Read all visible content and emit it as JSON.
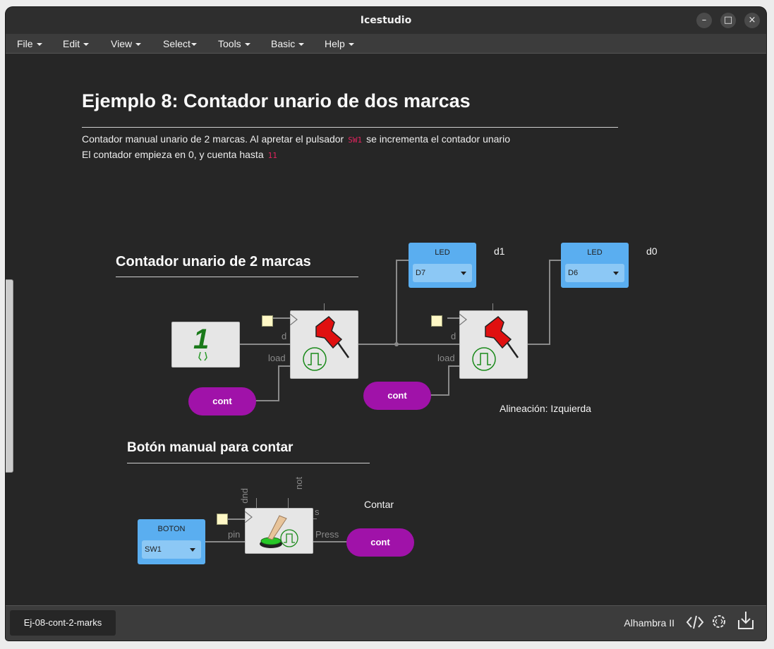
{
  "window": {
    "title": "Icestudio"
  },
  "menu": [
    {
      "label": "File"
    },
    {
      "label": "Edit"
    },
    {
      "label": "View"
    },
    {
      "label": "Select"
    },
    {
      "label": "Tools"
    },
    {
      "label": "Basic"
    },
    {
      "label": "Help"
    }
  ],
  "doc": {
    "title": "Ejemplo 8: Contador unario de dos marcas",
    "line1_a": "Contador manual unario de 2 marcas. Al apretar el pulsador",
    "line1_code": "SW1",
    "line1_b": "se incrementa el contador unario",
    "line2_a": "El contador empieza en 0, y cuenta hasta",
    "line2_code": "11"
  },
  "sections": {
    "counter_title": "Contador unario de 2 marcas",
    "button_title": "Botón manual para contar"
  },
  "circuit": {
    "led1": {
      "label": "LED",
      "pin": "D7",
      "name": "d1"
    },
    "led0": {
      "label": "LED",
      "pin": "D6",
      "name": "d0"
    },
    "const_value": "1",
    "reg_port_d": "d",
    "reg_port_load": "load",
    "cont_label": "cont",
    "align_note": "Alineación: Izquierda",
    "boton": {
      "label": "BOTON",
      "pin": "SW1"
    },
    "btn_ports": {
      "pup": "pup",
      "not": "not",
      "s": "s",
      "pin": "pin",
      "press": "Press"
    },
    "contar_note": "Contar"
  },
  "status": {
    "tab": "Ej-08-cont-2-marks",
    "board": "Alhambra II"
  },
  "colors": {
    "io_blue": "#5aaef0",
    "label_purple": "#a012a9",
    "background": "#262626"
  }
}
